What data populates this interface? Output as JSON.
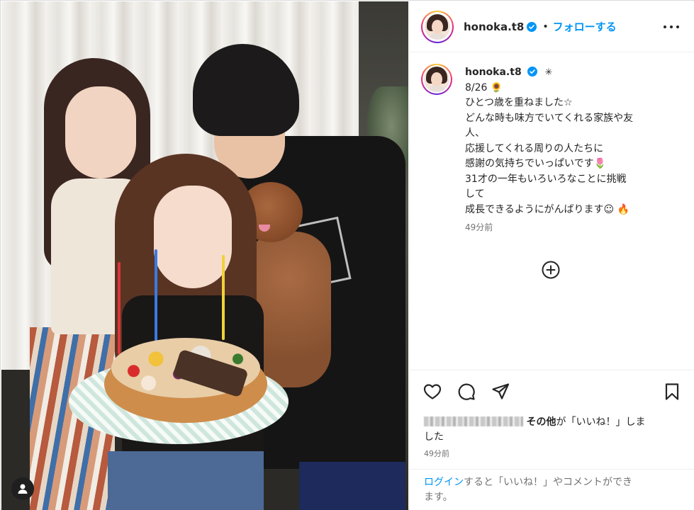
{
  "post": {
    "username": "honoka.t8",
    "follow_label": "フォローする",
    "dot": "•",
    "photo_alt": "photo",
    "avatar_glyph": "person"
  },
  "caption": {
    "username": "honoka.t8",
    "sparkle": "✳",
    "lines": [
      "8/26 🌻",
      "ひとつ歳を重ねました☆",
      "どんな時も味方でいてくれる家族や友",
      "人、",
      "応援してくれる周りの人たちに",
      "感謝の気持ちでいっぱいです🌷",
      "31才の一年もいろいろなことに挑戦",
      "して",
      "成長できるようにがんばります☺ 🔥"
    ],
    "time": "49分前"
  },
  "likes": {
    "others": "その他",
    "suffix": "が「いいね！」しま",
    "suffix2": "した"
  },
  "post_time": "49分前",
  "login": {
    "link": "ログイン",
    "text": "すると「いいね！」やコメントができ",
    "text2": "ます。"
  },
  "icons": {
    "like": "heart-icon",
    "comment": "comment-icon",
    "share": "share-icon",
    "save": "bookmark-icon",
    "more": "more-options-icon",
    "add": "add-circle-icon",
    "verified": "verified-badge-icon"
  },
  "colors": {
    "accent": "#0095f6",
    "text": "#262626",
    "muted": "#737373",
    "border": "#efefef"
  }
}
